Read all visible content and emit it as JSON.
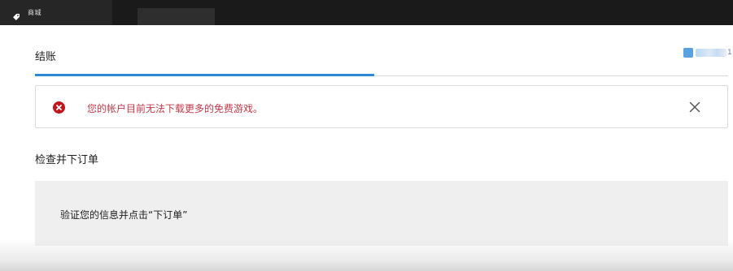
{
  "titlebar": {
    "tab_label": "商城",
    "tab_icon": "price-tag-icon"
  },
  "header": {
    "title": "结账",
    "account_trailing": "1"
  },
  "error": {
    "icon": "error-circle-icon",
    "message": "您的帐户目前无法下载更多的免费游戏。",
    "color": "#c2161f"
  },
  "review": {
    "title": "检查并下订单",
    "instruction": "验证您的信息并点击“下订单”"
  },
  "colors": {
    "accent": "#2a8ad8",
    "error_text": "#c23a4a"
  },
  "progress": {
    "checkout_fraction": 0.49
  }
}
